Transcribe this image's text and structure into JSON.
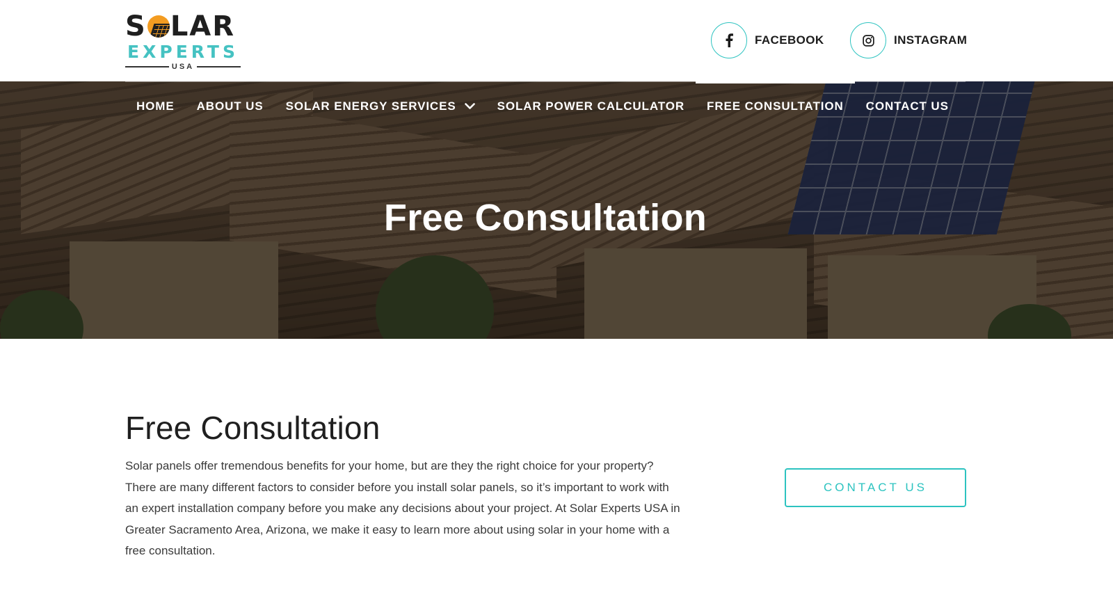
{
  "brand": {
    "logo_top_letters": [
      "S",
      "LAR"
    ],
    "logo_middle": "EXPERTS",
    "logo_bottom": "USA",
    "colors": {
      "accent": "#2cc3c0",
      "logo_teal": "#45c2c2",
      "logo_sun": "#f39c21",
      "dark": "#1f1f1f"
    }
  },
  "social": {
    "facebook": {
      "label": "FACEBOOK",
      "icon": "facebook-icon"
    },
    "instagram": {
      "label": "INSTAGRAM",
      "icon": "instagram-icon"
    }
  },
  "nav": {
    "items": [
      {
        "label": "HOME"
      },
      {
        "label": "ABOUT US"
      },
      {
        "label": "SOLAR ENERGY SERVICES",
        "has_dropdown": true
      },
      {
        "label": "SOLAR POWER CALCULATOR"
      },
      {
        "label": "FREE CONSULTATION",
        "active": true
      },
      {
        "label": "CONTACT US"
      }
    ]
  },
  "hero": {
    "title": "Free Consultation"
  },
  "main": {
    "title": "Free Consultation",
    "body": "Solar panels offer tremendous benefits for your home, but are they the right choice for your property? There are many different factors to consider before you install solar panels, so it’s important to work with an expert installation company before you make any decisions about your project. At Solar Experts USA in Greater Sacramento Area, Arizona, we make it easy to learn more about using solar in your home with a free consultation.",
    "cta_label": "CONTACT US"
  }
}
